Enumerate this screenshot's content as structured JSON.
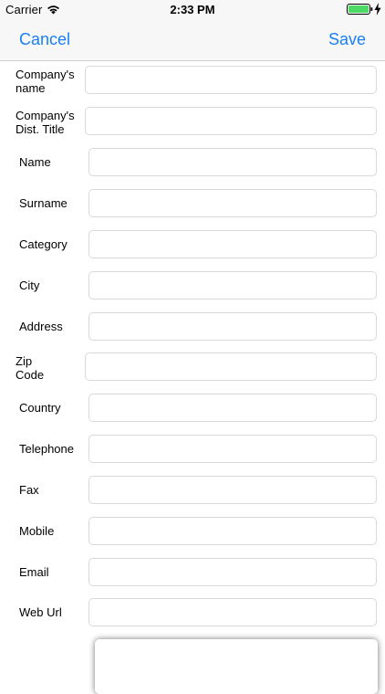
{
  "status_bar": {
    "carrier": "Carrier",
    "time": "2:33 PM",
    "wifi_icon": "wifi-icon",
    "battery_icon": "battery-icon",
    "charging_icon": "bolt-icon",
    "battery_color": "#4cd964"
  },
  "nav": {
    "cancel_label": "Cancel",
    "save_label": "Save",
    "accent_color": "#1a7ff5"
  },
  "form": {
    "fields": [
      {
        "label_line1": "Company's",
        "label_line2": "name",
        "value": ""
      },
      {
        "label_line1": "Company's",
        "label_line2": "Dist. Title",
        "value": ""
      },
      {
        "label": "Name",
        "value": ""
      },
      {
        "label": "Surname",
        "value": ""
      },
      {
        "label": "Category",
        "value": ""
      },
      {
        "label": "City",
        "value": ""
      },
      {
        "label": "Address",
        "value": ""
      },
      {
        "label_line1": "Zip",
        "label_line2": "Code",
        "value": ""
      },
      {
        "label": "Country",
        "value": ""
      },
      {
        "label": "Telephone",
        "value": ""
      },
      {
        "label": "Fax",
        "value": ""
      },
      {
        "label": "Mobile",
        "value": ""
      },
      {
        "label": "Email",
        "value": ""
      },
      {
        "label": "Web Url",
        "value": ""
      }
    ]
  }
}
